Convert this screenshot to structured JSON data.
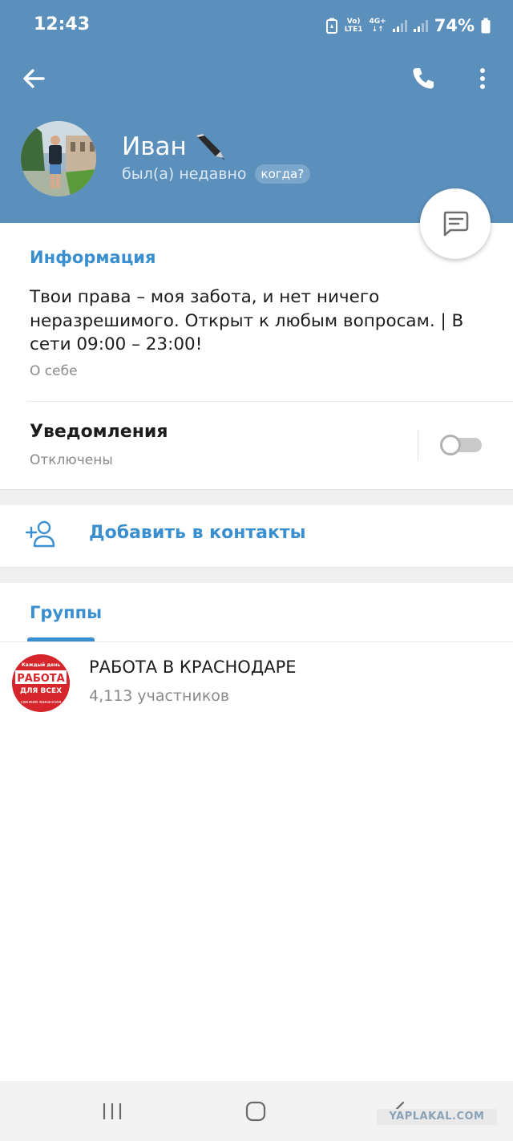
{
  "status_bar": {
    "time": "12:43",
    "net_top": "Vo)",
    "net_bottom": "LTE1",
    "gen_top": "4G+",
    "gen_bottom": "↓↑",
    "battery": "74%"
  },
  "header": {
    "name": "Иван",
    "last_seen": "был(а) недавно",
    "when_chip": "когда?",
    "accent_color": "#5b8fbc"
  },
  "info": {
    "section_title": "Информация",
    "bio": "Твои права – моя забота, и нет ничего неразрешимого. Открыт к любым вопросам. | В сети 09:00 – 23:00!",
    "bio_label": "О себе"
  },
  "notifications": {
    "title": "Уведомления",
    "state": "Отключены",
    "enabled": false
  },
  "actions": {
    "add_contact": "Добавить в контакты"
  },
  "tabs": {
    "groups": "Группы"
  },
  "groups": [
    {
      "name": "РАБОТА В КРАСНОДАРЕ",
      "members": "4,113 участников",
      "logo_top": "Каждый день",
      "logo_main": "РАБОТА",
      "logo_sub": "ДЛЯ ВСЕХ",
      "logo_bottom": "свежие вакансии"
    }
  ],
  "watermark": "YAPLAKAL.COM"
}
